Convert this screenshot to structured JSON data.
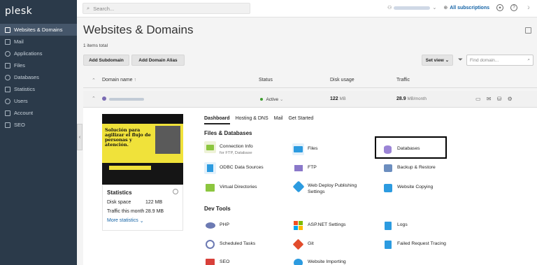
{
  "sidebar": {
    "logo": "plesk",
    "items": [
      {
        "label": "Websites & Domains"
      },
      {
        "label": "Mail"
      },
      {
        "label": "Applications"
      },
      {
        "label": "Files"
      },
      {
        "label": "Databases"
      },
      {
        "label": "Statistics"
      },
      {
        "label": "Users"
      },
      {
        "label": "Account"
      },
      {
        "label": "SEO"
      }
    ]
  },
  "topbar": {
    "search_placeholder": "Search...",
    "subscriptions": "All subscriptions"
  },
  "page": {
    "title": "Websites & Domains",
    "items_total": "1 items total",
    "add_subdomain": "Add Subdomain",
    "add_domain_alias": "Add Domain Alias",
    "set_view": "Set view",
    "find_placeholder": "Find domain..."
  },
  "table": {
    "col_domain": "Domain name",
    "col_status": "Status",
    "col_disk": "Disk usage",
    "col_traffic": "Traffic",
    "row": {
      "status": "Active",
      "disk_value": "122",
      "disk_unit": "MB",
      "traffic_value": "28.9",
      "traffic_unit": "MB/month"
    }
  },
  "preview": {
    "headline": "Solución para agilizar el flujo de personas y atención."
  },
  "statistics": {
    "title": "Statistics",
    "disk_label": "Disk space",
    "disk_value": "122 MB",
    "traffic_label": "Traffic this month",
    "traffic_value": "28.9 MB",
    "more": "More statistics"
  },
  "tabs": [
    "Dashboard",
    "Hosting & DNS",
    "Mail",
    "Get Started"
  ],
  "sections": {
    "files_db": "Files & Databases",
    "dev_tools": "Dev Tools"
  },
  "tools": {
    "connection_info": "Connection Info",
    "connection_sub": "for FTP, Database",
    "files": "Files",
    "databases": "Databases",
    "odbc": "ODBC Data Sources",
    "ftp": "FTP",
    "backup": "Backup & Restore",
    "virtual_dirs": "Virtual Directories",
    "web_deploy_1": "Web Deploy Publishing",
    "web_deploy_2": "Settings",
    "website_copying": "Website Copying",
    "php": "PHP",
    "aspnet": "ASP.NET Settings",
    "logs": "Logs",
    "scheduled": "Scheduled Tasks",
    "git": "Git",
    "failed_req": "Failed Request Tracing",
    "seo": "SEO",
    "website_importing": "Website Importing"
  },
  "colors": {
    "sidebar_bg": "#2b3a4a",
    "accent": "#1463a6",
    "active_green": "#3e9d2e"
  }
}
